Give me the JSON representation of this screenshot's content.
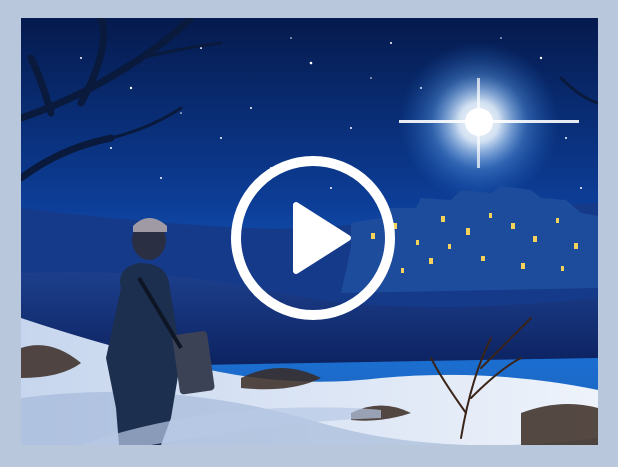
{
  "video": {
    "scene": "night-nativity-illustration",
    "play_icon": "play-circle-icon",
    "colors": {
      "frame": "#b8c7dc",
      "sky_top": "#06205a",
      "sky_bottom": "#1565c8",
      "star_glow": "#ffffff",
      "snow": "#dbe6f4",
      "play_fill": "#ffffff"
    }
  }
}
